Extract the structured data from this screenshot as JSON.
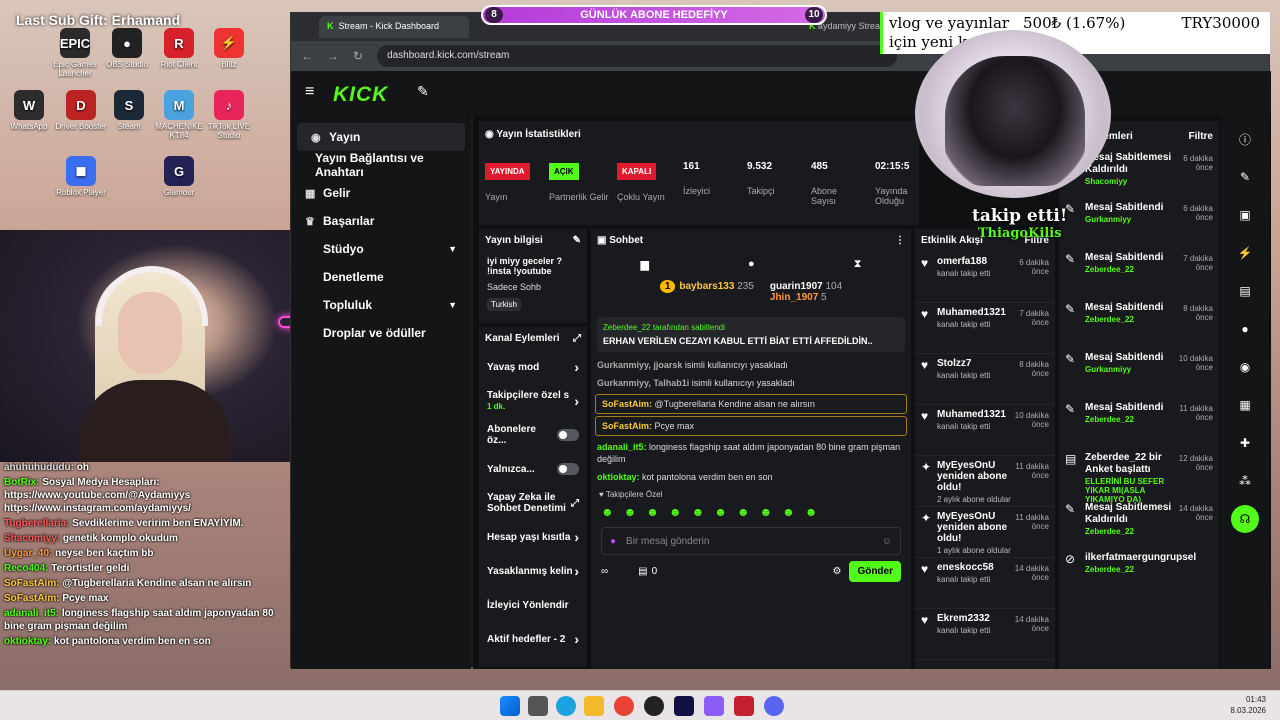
{
  "overlay": {
    "title": "Last Sub Gift: Erhamand"
  },
  "desktop": {
    "icons": [
      {
        "label": "Epic Games Launcher",
        "color": "#2a2a2a",
        "glyph": "EPIC"
      },
      {
        "label": "OBS Studio",
        "color": "#222",
        "glyph": "●"
      },
      {
        "label": "Riot Client",
        "color": "#d6202a",
        "glyph": "R"
      },
      {
        "label": "Blitz",
        "color": "#e33",
        "glyph": "⚡"
      },
      {
        "label": "WhatsApp",
        "color": "#2c2c2c",
        "glyph": "W"
      },
      {
        "label": "Driver Booster",
        "color": "#b22",
        "glyph": "D"
      },
      {
        "label": "Steam",
        "color": "#1b2838",
        "glyph": "S"
      },
      {
        "label": "MACHENIKE KT84",
        "color": "#4aa3df",
        "glyph": "M"
      },
      {
        "label": "TikTok LIVE Studio",
        "color": "#e8255a",
        "glyph": "♪"
      },
      {
        "label": "Roblox Player",
        "color": "#3a6df0",
        "glyph": "◼"
      },
      {
        "label": "Glamour",
        "color": "#225",
        "glyph": "G"
      }
    ]
  },
  "browser": {
    "tabs": [
      {
        "label": "Stream - Kick Dashboard"
      },
      {
        "label": "aydamiyy Stream"
      }
    ],
    "url": "dashboard.kick.com/stream"
  },
  "kick": {
    "logo": "KICK",
    "nav": [
      {
        "label": "Yayın",
        "icon": "(•)"
      },
      {
        "label": "Yayın Bağlantısı ve Anahtarı",
        "icon": ""
      },
      {
        "label": "Gelir",
        "icon": "▦"
      },
      {
        "label": "Başarılar",
        "icon": "♛"
      },
      {
        "label": "Stüdyo",
        "icon": ""
      },
      {
        "label": "Denetleme",
        "icon": ""
      },
      {
        "label": "Topluluk",
        "icon": ""
      },
      {
        "label": "Droplar ve ödüller",
        "icon": ""
      }
    ],
    "stats": {
      "title": "Yayın İstatistikleri",
      "items": [
        {
          "badge": "YAYINDA",
          "badge_color": "#e1192e",
          "label": "Yayın"
        },
        {
          "badge": "AÇIK",
          "badge_color": "#53fc18",
          "label": "Partnerlik Gelir"
        },
        {
          "badge": "KAPALI",
          "badge_color": "#e1192e",
          "label": "Çoklu Yayın"
        },
        {
          "value": "161",
          "label": "İzleyici"
        },
        {
          "value": "9.532",
          "label": "Takipçi"
        },
        {
          "value": "485",
          "label": "Abone Sayısı"
        },
        {
          "value": "02:15:5",
          "label": "Yayında Olduğu"
        }
      ]
    },
    "info": {
      "title": "Yayın bilgisi",
      "text": "iyi miyy geceler ? !insta !youtube",
      "category": "Sadece Sohb",
      "tag": "Turkish"
    },
    "actions": {
      "title": "Kanal Eylemleri",
      "items": [
        {
          "label": "Yavaş mod",
          "type": "arrow"
        },
        {
          "label": "Takipçilere özel s",
          "sub": "1 dk.",
          "type": "arrow"
        },
        {
          "label": "Abonelere öz...",
          "type": "toggle"
        },
        {
          "label": "Yalnızca...",
          "type": "toggle"
        },
        {
          "label": "Yapay Zeka ile Sohbet Denetimi",
          "type": "link"
        },
        {
          "label": "Hesap yaşı kısıtla",
          "type": "arrow"
        },
        {
          "label": "Yasaklanmış kelin",
          "type": "arrow"
        },
        {
          "label": "İzleyici Yönlendir",
          "type": "none"
        },
        {
          "label": "Aktif hedefler - 2",
          "type": "arrow"
        }
      ]
    },
    "chat": {
      "title": "Sohbet",
      "top": [
        {
          "user": "baybars133",
          "count": "235"
        },
        {
          "user": "guarin1907",
          "count": "104"
        },
        {
          "user": "Jhin_1907",
          "count": "5"
        }
      ],
      "pinned_by": "Zeberdee_22 tarafından sabitlendi",
      "pinned_text": "ERHAN VERİLEN CEZAYI KABUL ETTİ BİAT ETTİ AFFEDİLDİN..",
      "messages": [
        {
          "user": "Gurkanmiyy, jjoarsk",
          "text": "isimli kullanıcıyı yasakladı",
          "hl": false,
          "color": "#aaa"
        },
        {
          "user": "Gurkanmiyy, Talhab1i",
          "text": "isimli kullanıcıyı yasakladı",
          "hl": false,
          "color": "#aaa"
        },
        {
          "user": "SoFastAim:",
          "text": "@Tugberellaria Kendine alsan ne alırsın",
          "hl": true,
          "color": "#ffc83d"
        },
        {
          "user": "SoFastAim:",
          "text": "Pcye max",
          "hl": true,
          "color": "#ffc83d"
        },
        {
          "user": "adanali_it5:",
          "text": "longiness flagship saat aldım japonyadan 80 bine gram pişman değilim",
          "hl": false,
          "color": "#53fc18"
        },
        {
          "user": "oktioktay:",
          "text": "kot pantolona verdim ben en son",
          "hl": false,
          "color": "#53fc18"
        }
      ],
      "emote_label": "Takipçilere Özel",
      "placeholder": "Bir mesaj gönderin",
      "send": "Gönder",
      "footer_count": "0"
    },
    "events": {
      "title": "Etkinlik Akışı",
      "filter": "Filtre",
      "items": [
        {
          "name": "omerfa188",
          "sub": "kanalı takip etti",
          "time": "6 dakika önce",
          "icon": "♥"
        },
        {
          "name": "Muhamed1321",
          "sub": "kanalı takip etti",
          "time": "7 dakika önce",
          "icon": "♥"
        },
        {
          "name": "Stolzz7",
          "sub": "kanalı takip etti",
          "time": "8 dakika önce",
          "icon": "♥"
        },
        {
          "name": "Muhamed1321",
          "sub": "kanalı takip etti",
          "time": "10 dakika önce",
          "icon": "♥"
        },
        {
          "name": "MyEyesOnU yeniden abone oldu!",
          "sub": "2 aylık abone oldular",
          "time": "11 dakika önce",
          "icon": "✦"
        },
        {
          "name": "MyEyesOnU yeniden abone oldu!",
          "sub": "1 aylık abone oldular",
          "time": "11 dakika önce",
          "icon": "✦"
        },
        {
          "name": "eneskocc58",
          "sub": "kanalı takip etti",
          "time": "14 dakika önce",
          "icon": "♥"
        },
        {
          "name": "Ekrem2332",
          "sub": "kanalı takip etti",
          "time": "14 dakika önce",
          "icon": "♥"
        }
      ]
    },
    "modlog": {
      "title": "Mod Eylemleri",
      "filter": "Filtre",
      "items": [
        {
          "name": "Mesaj Sabitlemesi Kaldırıldı",
          "by": "Shacomiyy",
          "time": "6 dakika önce",
          "icon": "✎"
        },
        {
          "name": "Mesaj Sabitlendi",
          "by": "Gurkanmiyy",
          "time": "6 dakika önce",
          "icon": "✎"
        },
        {
          "name": "Mesaj Sabitlendi",
          "by": "Zeberdee_22",
          "time": "7 dakika önce",
          "icon": "✎"
        },
        {
          "name": "Mesaj Sabitlendi",
          "by": "Zeberdee_22",
          "time": "8 dakika önce",
          "icon": "✎"
        },
        {
          "name": "Mesaj Sabitlendi",
          "by": "Gurkanmiyy",
          "time": "10 dakika önce",
          "icon": "✎"
        },
        {
          "name": "Mesaj Sabitlendi",
          "by": "Zeberdee_22",
          "time": "11 dakika önce",
          "icon": "✎"
        },
        {
          "name": "Zeberdee_22 bir Anket başlattı",
          "by": "ELLERİNİ BU SEFER YIKAR MI(ASLA YIKAMIYO DA)",
          "time": "12 dakika önce",
          "icon": "▤"
        },
        {
          "name": "Mesaj Sabitlemesi Kaldırıldı",
          "by": "Zeberdee_22",
          "time": "14 dakika önce",
          "icon": "✎"
        },
        {
          "name": "ilkerfatmaergungrupsel",
          "by": "Zeberdee_22",
          "time": "",
          "icon": "⊘"
        }
      ]
    }
  },
  "goal": {
    "label": "GÜNLÜK ABONE HEDEFİYY",
    "current": "8",
    "target": "10"
  },
  "tip": {
    "text": "vlog ve yayınlar için yeni kamera",
    "amount": "500₺ (1.67%)",
    "target": "TRY30000"
  },
  "follow_alert": {
    "text": "takip etti!",
    "name": "ThiagoKilis"
  },
  "overlay_chat": [
    {
      "user": "ahuhuhududu:",
      "text": "oh",
      "color": "#ddd"
    },
    {
      "user": "BotRix:",
      "text": "Sosyal Medya Hesapları: https://www.youtube.com/@Aydamiyys https://www.instagram.com/aydamiyys/",
      "color": "#53fc18"
    },
    {
      "user": "Tugberellaria:",
      "text": "Sevdiklerime veririm ben ENAYİYİM.",
      "color": "#ff5b5b"
    },
    {
      "user": "Shacomiyy:",
      "text": "genetik komplo okudum",
      "color": "#ff5b5b"
    },
    {
      "user": "Uygar_40:",
      "text": "neyse ben kaçtım bb",
      "color": "#ff9a3c"
    },
    {
      "user": "Reco404:",
      "text": "Terörtistler geldi",
      "color": "#53fc18"
    },
    {
      "user": "SoFastAim:",
      "text": "@Tugberellaria Kendine alsan ne alırsın",
      "color": "#ffc83d"
    },
    {
      "user": "SoFastAim:",
      "text": "Pcye max",
      "color": "#ffc83d"
    },
    {
      "user": "adanali_it5:",
      "text": "longiness flagship saat aldım japonyadan 80 bine gram pişman değilim",
      "color": "#53fc18"
    },
    {
      "user": "oktioktay:",
      "text": "kot pantolona verdim ben en son",
      "color": "#53fc18"
    }
  ],
  "taskbar": {
    "time": "01:43",
    "date": "8.03.2026"
  }
}
